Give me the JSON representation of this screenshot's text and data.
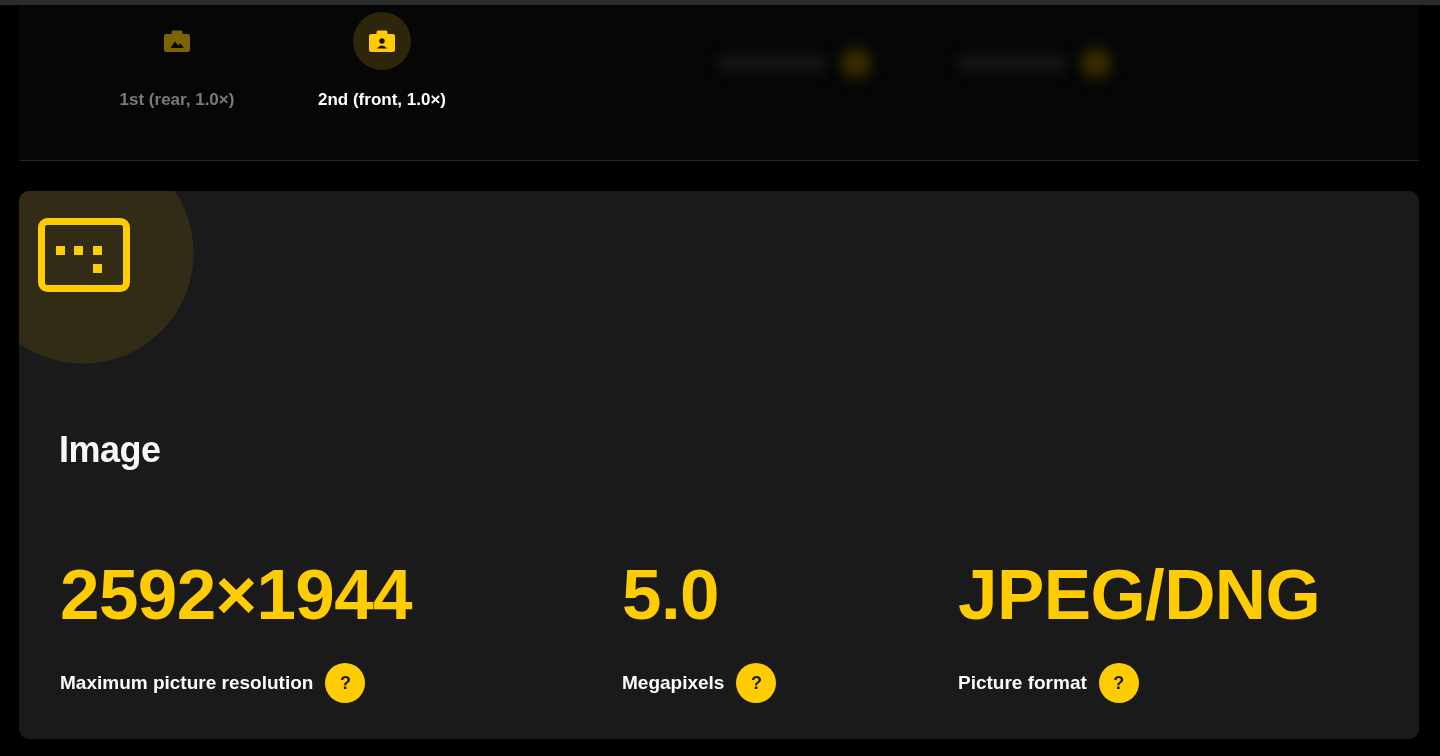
{
  "camera_tabs": [
    {
      "kind": "rear",
      "label": "1st (rear, 1.0×)",
      "selected": false
    },
    {
      "kind": "front",
      "label": "2nd (front, 1.0×)",
      "selected": true
    }
  ],
  "image_section": {
    "title": "Image",
    "stats": [
      {
        "value": "2592×1944",
        "label": "Maximum picture resolution",
        "help": "?"
      },
      {
        "value": "5.0",
        "label": "Megapixels",
        "help": "?"
      },
      {
        "value": "JPEG/DNG",
        "label": "Picture format",
        "help": "?"
      }
    ]
  }
}
